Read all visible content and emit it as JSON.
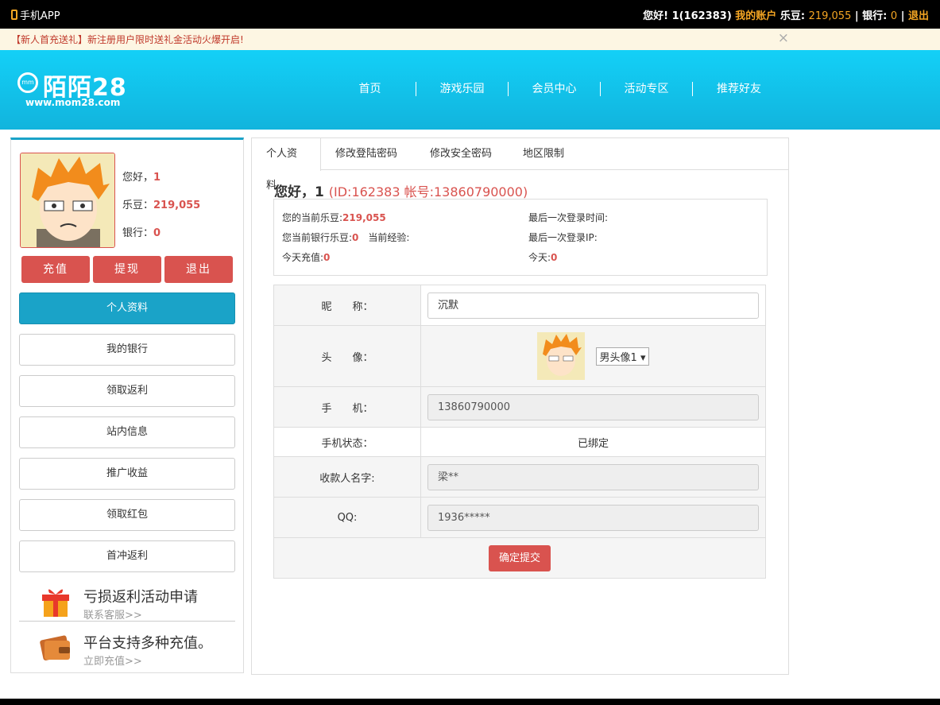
{
  "topbar": {
    "app_label": "手机APP",
    "greeting": "您好! 1(162383)",
    "account_link": "我的账户",
    "ledou_label": "乐豆:",
    "ledou_value": "219,055",
    "bank_label": "银行:",
    "bank_value": "0",
    "logout": "退出",
    "sep": "|"
  },
  "notice": {
    "text": "【新人首充送礼】新注册用户限时送礼金活动火爆开启!",
    "close": "×"
  },
  "logo": {
    "mark": "mm",
    "name": "陌陌28",
    "url": "www.mom28.com"
  },
  "nav": [
    "首页",
    "游戏乐园",
    "会员中心",
    "活动专区",
    "推荐好友"
  ],
  "profile": {
    "hello_label": "您好，",
    "hello_value": "1",
    "ledou_label": "乐豆：",
    "ledou_value": "219,055",
    "bank_label": "银行：",
    "bank_value": "0"
  },
  "actions": [
    "充值",
    "提现",
    "退出"
  ],
  "menu": [
    "个人资料",
    "我的银行",
    "领取返利",
    "站内信息",
    "推广收益",
    "领取红包",
    "首冲返利"
  ],
  "promos": [
    {
      "title": "亏损返利活动申请",
      "sub": "联系客服>>"
    },
    {
      "title": "平台支持多种充值。",
      "sub": "立即充值>>"
    }
  ],
  "tabs": [
    "个人资料",
    "修改登陆密码",
    "修改安全密码",
    "地区限制"
  ],
  "greet": {
    "text": "您好，1",
    "id": "(ID:162383 帐号:13860790000)"
  },
  "stats": {
    "cur_ledou_label": "您的当前乐豆:",
    "cur_ledou_value": "219,055",
    "bank_ledou_label": "您当前银行乐豆:",
    "bank_ledou_value": "0",
    "exp_label": "当前经验:",
    "today_recharge_label": "今天充值:",
    "today_recharge_value": "0",
    "last_login_time_label": "最后一次登录时间:",
    "last_login_ip_label": "最后一次登录IP:",
    "today_label": "今天:",
    "today_value": "0"
  },
  "form": {
    "nickname_label": "昵　　称：",
    "nickname_value": "沉默",
    "avatar_label": "头　　像：",
    "avatar_option": "男头像1",
    "phone_label": "手　　机：",
    "phone_value": "13860790000",
    "phone_status_label": "手机状态：",
    "phone_status_value": "已绑定",
    "payee_label": "收款人名字:",
    "payee_value": "梁**",
    "qq_label": "QQ:",
    "qq_value": "1936*****",
    "submit": "确定提交"
  },
  "colors": {
    "brand": "#13c4ee",
    "accent": "#d9534f",
    "gold": "#f5a623"
  }
}
